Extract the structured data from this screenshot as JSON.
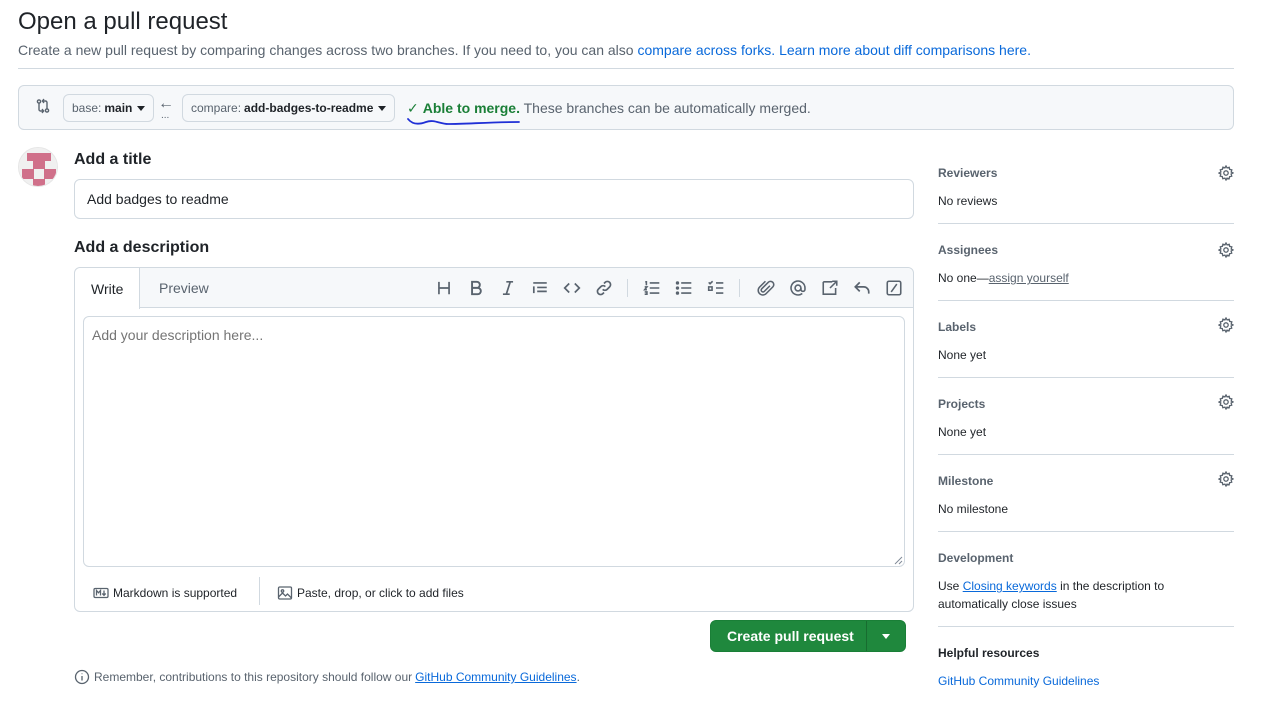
{
  "page": {
    "title": "Open a pull request",
    "subtitle_text": "Create a new pull request by comparing changes across two branches. If you need to, you can also ",
    "link_forks": "compare across forks.",
    "link_learn": "Learn more about diff comparisons here."
  },
  "range": {
    "base_prefix": "base:",
    "base_value": "main",
    "compare_prefix": "compare:",
    "compare_value": "add-badges-to-readme",
    "dots": "...",
    "check_glyph": "✓",
    "merge_ok": "Able to merge.",
    "merge_desc": " These branches can be automatically merged."
  },
  "form": {
    "title_label": "Add a title",
    "title_value": "Add badges to readme",
    "desc_label": "Add a description",
    "desc_placeholder": "Add your description here...",
    "tab_write": "Write",
    "tab_preview": "Preview",
    "markdown_note": "Markdown is supported",
    "attach_note": "Paste, drop, or click to add files",
    "create_label": "Create pull request"
  },
  "toolbar": {
    "icons": [
      "heading-icon",
      "bold-icon",
      "italic-icon",
      "quote-icon",
      "code-icon",
      "link-icon",
      "ordered-list-icon",
      "unordered-list-icon",
      "task-list-icon",
      "attach-icon",
      "mention-icon",
      "reference-icon",
      "reply-icon",
      "slash-command-icon"
    ]
  },
  "footer": {
    "remember_text": "Remember, contributions to this repository should follow our",
    "guidelines_link": "GitHub Community Guidelines",
    "period": "."
  },
  "sidebar": {
    "reviewers": {
      "heading": "Reviewers",
      "value": "No reviews"
    },
    "assignees": {
      "heading": "Assignees",
      "value_prefix": "No one—",
      "value_link": "assign yourself"
    },
    "labels": {
      "heading": "Labels",
      "value": "None yet"
    },
    "projects": {
      "heading": "Projects",
      "value": "None yet"
    },
    "milestone": {
      "heading": "Milestone",
      "value": "No milestone"
    },
    "development": {
      "heading": "Development",
      "text_prefix": "Use ",
      "link": "Closing keywords",
      "text_suffix": " in the description to automatically close issues"
    },
    "helpful": {
      "heading": "Helpful resources",
      "link": "GitHub Community Guidelines"
    }
  },
  "colors": {
    "accent_link": "#0969da",
    "success": "#1a7f37",
    "primary_button": "#1f883d",
    "scribble": "#1f2fd6"
  }
}
